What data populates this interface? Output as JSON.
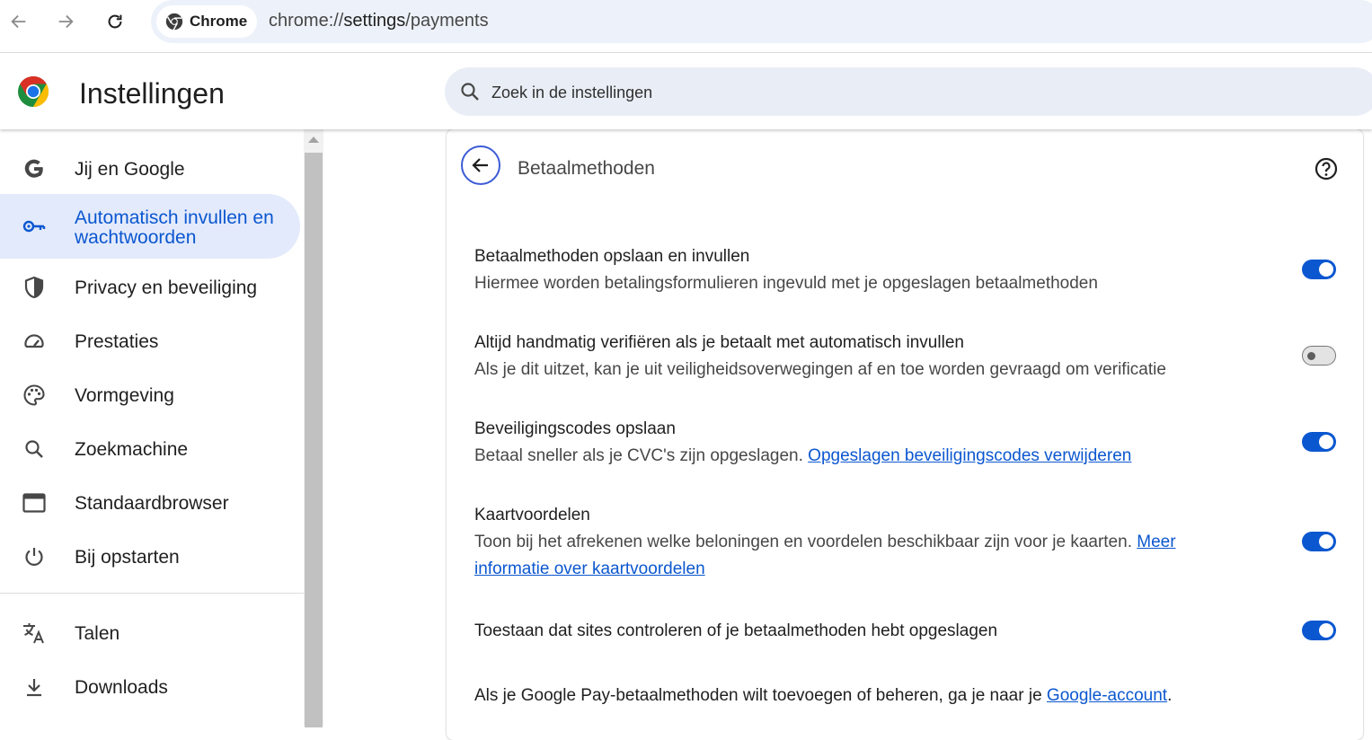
{
  "browser": {
    "chip_label": "Chrome",
    "url_scheme": "chrome://",
    "url_host": "settings",
    "url_path": "/payments"
  },
  "header": {
    "title": "Instellingen",
    "search_placeholder": "Zoek in de instellingen"
  },
  "sidebar": {
    "items": [
      {
        "label": "Jij en Google",
        "icon": "google-g-icon"
      },
      {
        "label": "Automatisch invullen en wachtwoorden",
        "icon": "key-icon",
        "active": true
      },
      {
        "label": "Privacy en beveiliging",
        "icon": "shield-icon"
      },
      {
        "label": "Prestaties",
        "icon": "speedometer-icon"
      },
      {
        "label": "Vormgeving",
        "icon": "palette-icon"
      },
      {
        "label": "Zoekmachine",
        "icon": "search-icon"
      },
      {
        "label": "Standaardbrowser",
        "icon": "browser-window-icon"
      },
      {
        "label": "Bij opstarten",
        "icon": "power-icon"
      },
      {
        "label": "Talen",
        "icon": "translate-icon"
      },
      {
        "label": "Downloads",
        "icon": "download-icon"
      }
    ]
  },
  "card": {
    "title": "Betaalmethoden",
    "rows": [
      {
        "title": "Betaalmethoden opslaan en invullen",
        "subtitle": "Hiermee worden betalingsformulieren ingevuld met je opgeslagen betaalmethoden",
        "enabled": true
      },
      {
        "title": "Altijd handmatig verifiëren als je betaalt met automatisch invullen",
        "subtitle": "Als je dit uitzet, kan je uit veiligheidsoverwegingen af en toe worden gevraagd om verificatie",
        "enabled": false
      },
      {
        "title": "Beveiligingscodes opslaan",
        "subtitle": "Betaal sneller als je CVC's zijn opgeslagen.",
        "link": "Opgeslagen beveiligingscodes verwijderen",
        "enabled": true
      },
      {
        "title": "Kaartvoordelen",
        "subtitle": "Toon bij het afrekenen welke beloningen en voordelen beschikbaar zijn voor je kaarten.",
        "link": "Meer informatie over kaartvoordelen",
        "enabled": true
      },
      {
        "title": "Toestaan dat sites controleren of je betaalmethoden hebt opgeslagen",
        "enabled": true
      }
    ],
    "footer_text": "Als je Google Pay-betaalmethoden wilt toevoegen of beheren, ga je naar je",
    "footer_link": "Google-account",
    "footer_end": "."
  },
  "colors": {
    "accent": "#0b57d0",
    "active_nav_bg": "#e3eafb",
    "omnibox_bg": "#edf2fa"
  }
}
